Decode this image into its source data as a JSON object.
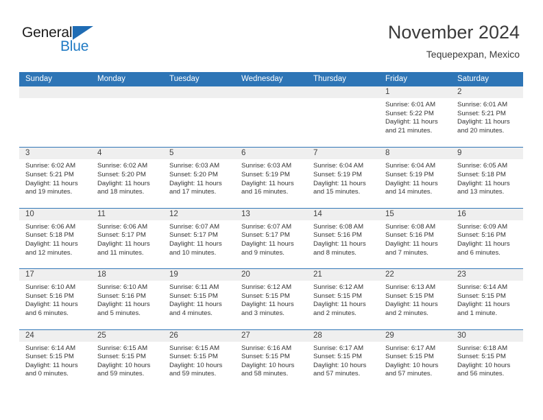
{
  "brand": {
    "name_top": "General",
    "name_bottom": "Blue",
    "triangle_icon": "triangle-logo-icon",
    "accent_color": "#1f7ac4"
  },
  "header": {
    "title": "November 2024",
    "location": "Tequepexpan, Mexico"
  },
  "theme": {
    "header_blue": "#2e75b6",
    "day_number_band": "#efefef",
    "text": "#333333"
  },
  "weekdays": [
    "Sunday",
    "Monday",
    "Tuesday",
    "Wednesday",
    "Thursday",
    "Friday",
    "Saturday"
  ],
  "weeks": [
    [
      {
        "day": "",
        "empty": true
      },
      {
        "day": "",
        "empty": true
      },
      {
        "day": "",
        "empty": true
      },
      {
        "day": "",
        "empty": true
      },
      {
        "day": "",
        "empty": true
      },
      {
        "day": "1",
        "sunrise": "Sunrise: 6:01 AM",
        "sunset": "Sunset: 5:22 PM",
        "daylight1": "Daylight: 11 hours",
        "daylight2": "and 21 minutes."
      },
      {
        "day": "2",
        "sunrise": "Sunrise: 6:01 AM",
        "sunset": "Sunset: 5:21 PM",
        "daylight1": "Daylight: 11 hours",
        "daylight2": "and 20 minutes."
      }
    ],
    [
      {
        "day": "3",
        "sunrise": "Sunrise: 6:02 AM",
        "sunset": "Sunset: 5:21 PM",
        "daylight1": "Daylight: 11 hours",
        "daylight2": "and 19 minutes."
      },
      {
        "day": "4",
        "sunrise": "Sunrise: 6:02 AM",
        "sunset": "Sunset: 5:20 PM",
        "daylight1": "Daylight: 11 hours",
        "daylight2": "and 18 minutes."
      },
      {
        "day": "5",
        "sunrise": "Sunrise: 6:03 AM",
        "sunset": "Sunset: 5:20 PM",
        "daylight1": "Daylight: 11 hours",
        "daylight2": "and 17 minutes."
      },
      {
        "day": "6",
        "sunrise": "Sunrise: 6:03 AM",
        "sunset": "Sunset: 5:19 PM",
        "daylight1": "Daylight: 11 hours",
        "daylight2": "and 16 minutes."
      },
      {
        "day": "7",
        "sunrise": "Sunrise: 6:04 AM",
        "sunset": "Sunset: 5:19 PM",
        "daylight1": "Daylight: 11 hours",
        "daylight2": "and 15 minutes."
      },
      {
        "day": "8",
        "sunrise": "Sunrise: 6:04 AM",
        "sunset": "Sunset: 5:19 PM",
        "daylight1": "Daylight: 11 hours",
        "daylight2": "and 14 minutes."
      },
      {
        "day": "9",
        "sunrise": "Sunrise: 6:05 AM",
        "sunset": "Sunset: 5:18 PM",
        "daylight1": "Daylight: 11 hours",
        "daylight2": "and 13 minutes."
      }
    ],
    [
      {
        "day": "10",
        "sunrise": "Sunrise: 6:06 AM",
        "sunset": "Sunset: 5:18 PM",
        "daylight1": "Daylight: 11 hours",
        "daylight2": "and 12 minutes."
      },
      {
        "day": "11",
        "sunrise": "Sunrise: 6:06 AM",
        "sunset": "Sunset: 5:17 PM",
        "daylight1": "Daylight: 11 hours",
        "daylight2": "and 11 minutes."
      },
      {
        "day": "12",
        "sunrise": "Sunrise: 6:07 AM",
        "sunset": "Sunset: 5:17 PM",
        "daylight1": "Daylight: 11 hours",
        "daylight2": "and 10 minutes."
      },
      {
        "day": "13",
        "sunrise": "Sunrise: 6:07 AM",
        "sunset": "Sunset: 5:17 PM",
        "daylight1": "Daylight: 11 hours",
        "daylight2": "and 9 minutes."
      },
      {
        "day": "14",
        "sunrise": "Sunrise: 6:08 AM",
        "sunset": "Sunset: 5:16 PM",
        "daylight1": "Daylight: 11 hours",
        "daylight2": "and 8 minutes."
      },
      {
        "day": "15",
        "sunrise": "Sunrise: 6:08 AM",
        "sunset": "Sunset: 5:16 PM",
        "daylight1": "Daylight: 11 hours",
        "daylight2": "and 7 minutes."
      },
      {
        "day": "16",
        "sunrise": "Sunrise: 6:09 AM",
        "sunset": "Sunset: 5:16 PM",
        "daylight1": "Daylight: 11 hours",
        "daylight2": "and 6 minutes."
      }
    ],
    [
      {
        "day": "17",
        "sunrise": "Sunrise: 6:10 AM",
        "sunset": "Sunset: 5:16 PM",
        "daylight1": "Daylight: 11 hours",
        "daylight2": "and 6 minutes."
      },
      {
        "day": "18",
        "sunrise": "Sunrise: 6:10 AM",
        "sunset": "Sunset: 5:16 PM",
        "daylight1": "Daylight: 11 hours",
        "daylight2": "and 5 minutes."
      },
      {
        "day": "19",
        "sunrise": "Sunrise: 6:11 AM",
        "sunset": "Sunset: 5:15 PM",
        "daylight1": "Daylight: 11 hours",
        "daylight2": "and 4 minutes."
      },
      {
        "day": "20",
        "sunrise": "Sunrise: 6:12 AM",
        "sunset": "Sunset: 5:15 PM",
        "daylight1": "Daylight: 11 hours",
        "daylight2": "and 3 minutes."
      },
      {
        "day": "21",
        "sunrise": "Sunrise: 6:12 AM",
        "sunset": "Sunset: 5:15 PM",
        "daylight1": "Daylight: 11 hours",
        "daylight2": "and 2 minutes."
      },
      {
        "day": "22",
        "sunrise": "Sunrise: 6:13 AM",
        "sunset": "Sunset: 5:15 PM",
        "daylight1": "Daylight: 11 hours",
        "daylight2": "and 2 minutes."
      },
      {
        "day": "23",
        "sunrise": "Sunrise: 6:14 AM",
        "sunset": "Sunset: 5:15 PM",
        "daylight1": "Daylight: 11 hours",
        "daylight2": "and 1 minute."
      }
    ],
    [
      {
        "day": "24",
        "sunrise": "Sunrise: 6:14 AM",
        "sunset": "Sunset: 5:15 PM",
        "daylight1": "Daylight: 11 hours",
        "daylight2": "and 0 minutes."
      },
      {
        "day": "25",
        "sunrise": "Sunrise: 6:15 AM",
        "sunset": "Sunset: 5:15 PM",
        "daylight1": "Daylight: 10 hours",
        "daylight2": "and 59 minutes."
      },
      {
        "day": "26",
        "sunrise": "Sunrise: 6:15 AM",
        "sunset": "Sunset: 5:15 PM",
        "daylight1": "Daylight: 10 hours",
        "daylight2": "and 59 minutes."
      },
      {
        "day": "27",
        "sunrise": "Sunrise: 6:16 AM",
        "sunset": "Sunset: 5:15 PM",
        "daylight1": "Daylight: 10 hours",
        "daylight2": "and 58 minutes."
      },
      {
        "day": "28",
        "sunrise": "Sunrise: 6:17 AM",
        "sunset": "Sunset: 5:15 PM",
        "daylight1": "Daylight: 10 hours",
        "daylight2": "and 57 minutes."
      },
      {
        "day": "29",
        "sunrise": "Sunrise: 6:17 AM",
        "sunset": "Sunset: 5:15 PM",
        "daylight1": "Daylight: 10 hours",
        "daylight2": "and 57 minutes."
      },
      {
        "day": "30",
        "sunrise": "Sunrise: 6:18 AM",
        "sunset": "Sunset: 5:15 PM",
        "daylight1": "Daylight: 10 hours",
        "daylight2": "and 56 minutes."
      }
    ]
  ]
}
